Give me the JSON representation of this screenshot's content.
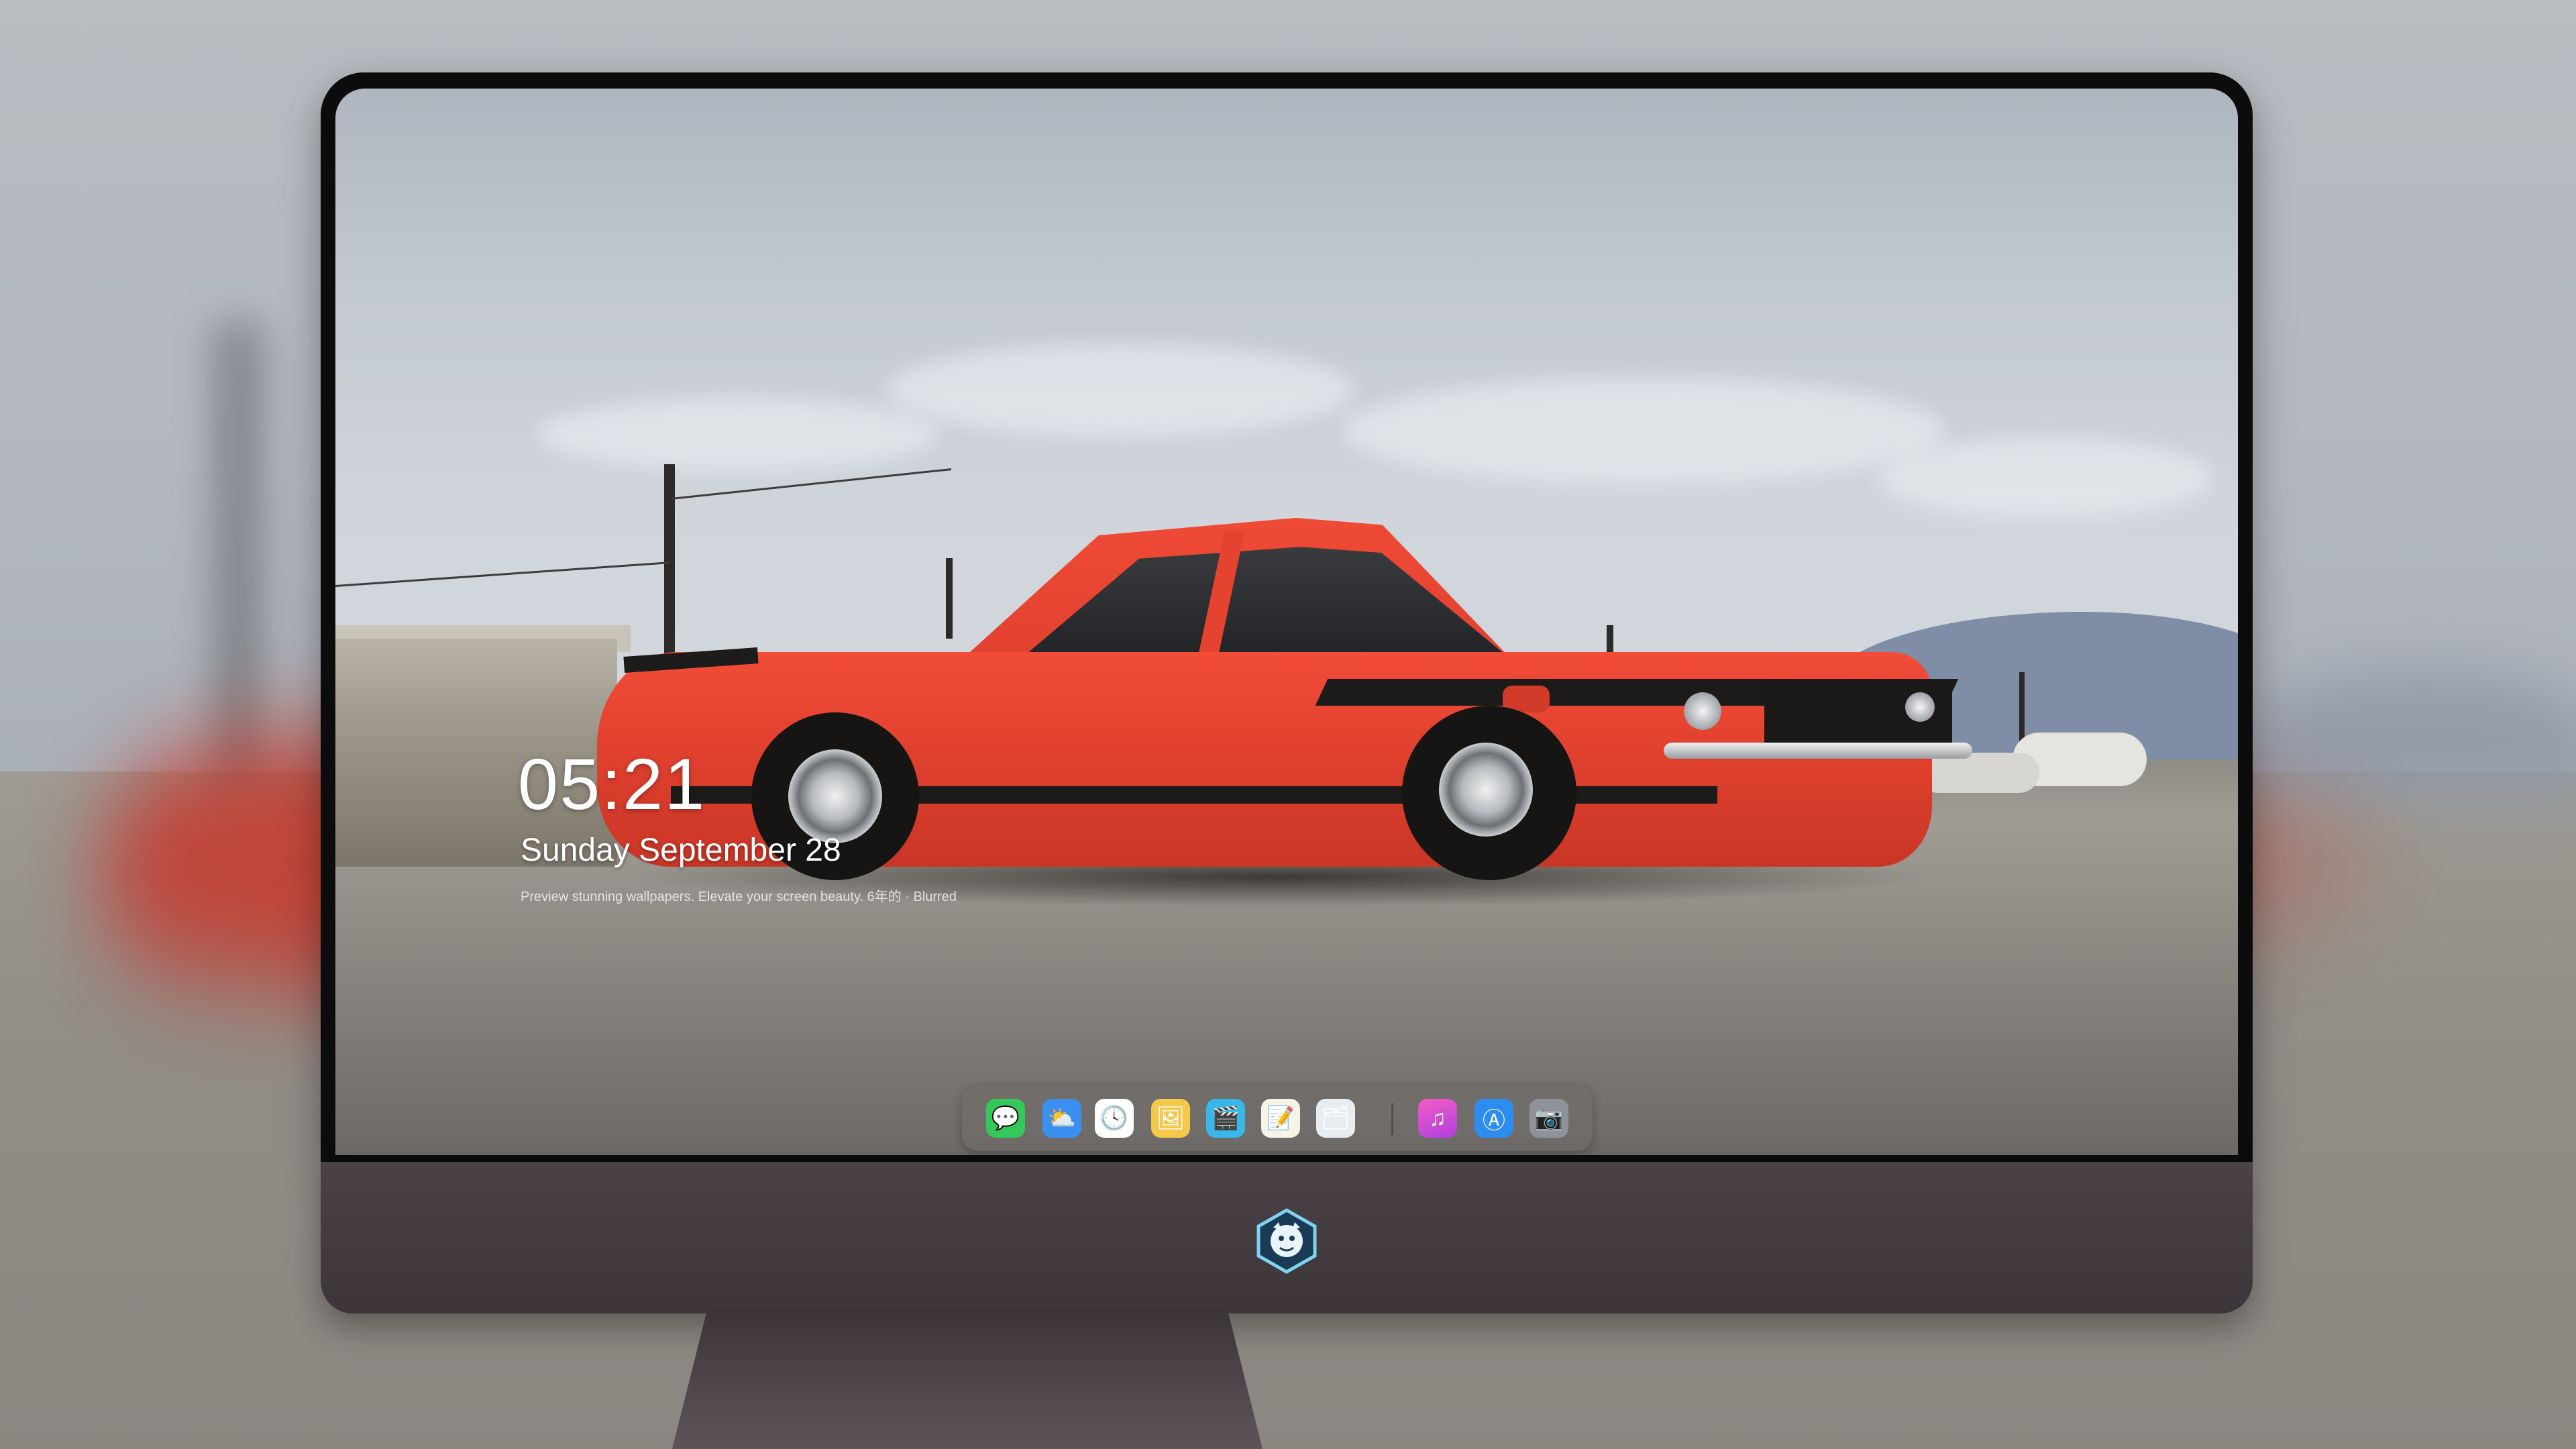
{
  "lockscreen": {
    "time": "05:21",
    "date": "Sunday September 28",
    "caption": "Preview stunning wallpapers. Elevate your screen beauty. 6年的 · Blurred"
  },
  "dock": {
    "apps": [
      {
        "name": "Messages",
        "icon": "messages-icon",
        "glyph": "💬",
        "color": "#2ecc5a"
      },
      {
        "name": "Weather",
        "icon": "weather-icon",
        "glyph": "⛅",
        "color": "#3a8ff0"
      },
      {
        "name": "Clock",
        "icon": "clock-icon",
        "glyph": "🕓",
        "color": "#ffffff"
      },
      {
        "name": "Preview",
        "icon": "preview-icon",
        "glyph": "🖼",
        "color": "#f4c84a"
      },
      {
        "name": "Clips",
        "icon": "clips-icon",
        "glyph": "🎬",
        "color": "#38b8e8"
      },
      {
        "name": "Notes",
        "icon": "notes-icon",
        "glyph": "📝",
        "color": "#f7d54a"
      },
      {
        "name": "Photo Gallery",
        "icon": "gallery-icon",
        "glyph": "🗂",
        "color": "#e8edf2"
      },
      {
        "name": "Music",
        "icon": "music-icon",
        "glyph": "♫",
        "color": "#e64bd3"
      },
      {
        "name": "App Store",
        "icon": "app-store-icon",
        "glyph": "Ⓐ",
        "color": "#2d8cf0"
      },
      {
        "name": "Camera",
        "icon": "camera-icon",
        "glyph": "📷",
        "color": "#8f9399"
      }
    ]
  },
  "colors": {
    "monitor_chin": "#3f383c",
    "bezel": "#0c0c0d",
    "car_red": "#e2412f"
  }
}
